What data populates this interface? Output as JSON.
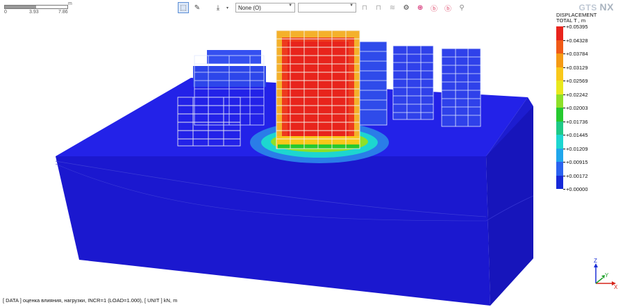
{
  "scale_bar": {
    "unit": "m",
    "ticks": [
      "0",
      "3.93",
      "7.86"
    ]
  },
  "toolbar": {
    "dropdown_value": "None (O)",
    "dropdown2_value": ""
  },
  "logo": {
    "text": "GTS",
    "nx": "NX"
  },
  "legend": {
    "title_line1": "DISPLACEMENT",
    "title_line2": "TOTAL T , m",
    "entries": [
      {
        "label": "+0.05395",
        "color": "#e8241c"
      },
      {
        "label": "+0.04328",
        "color": "#f05a17"
      },
      {
        "label": "+0.03784",
        "color": "#f59a14"
      },
      {
        "label": "+0.03129",
        "color": "#f9c81a"
      },
      {
        "label": "+0.02569",
        "color": "#e9e81e"
      },
      {
        "label": "+0.02242",
        "color": "#8ee028"
      },
      {
        "label": "+0.02003",
        "color": "#26c92f"
      },
      {
        "label": "+0.01736",
        "color": "#1ec987"
      },
      {
        "label": "+0.01445",
        "color": "#1dd6d0"
      },
      {
        "label": "+0.01209",
        "color": "#1fa6ec"
      },
      {
        "label": "+0.00915",
        "color": "#2a62f0"
      },
      {
        "label": "+0.00172",
        "color": "#1628d8"
      },
      {
        "label": "+0.00000",
        "color": ""
      }
    ]
  },
  "model": {
    "soil_color": "#1d1fe0",
    "core_colors": [
      "#e8241c",
      "#f05a17",
      "#f59a14",
      "#e9e81e",
      "#26c92f",
      "#1dd6d0",
      "#2a62f0"
    ]
  },
  "status": {
    "text": "[ DATA ] оценка влияния, нагрузки, INCR=1 (LOAD=1.000), [ UNIT ] kN, m"
  },
  "axes": {
    "x": "X",
    "y": "Y",
    "z": "Z"
  }
}
